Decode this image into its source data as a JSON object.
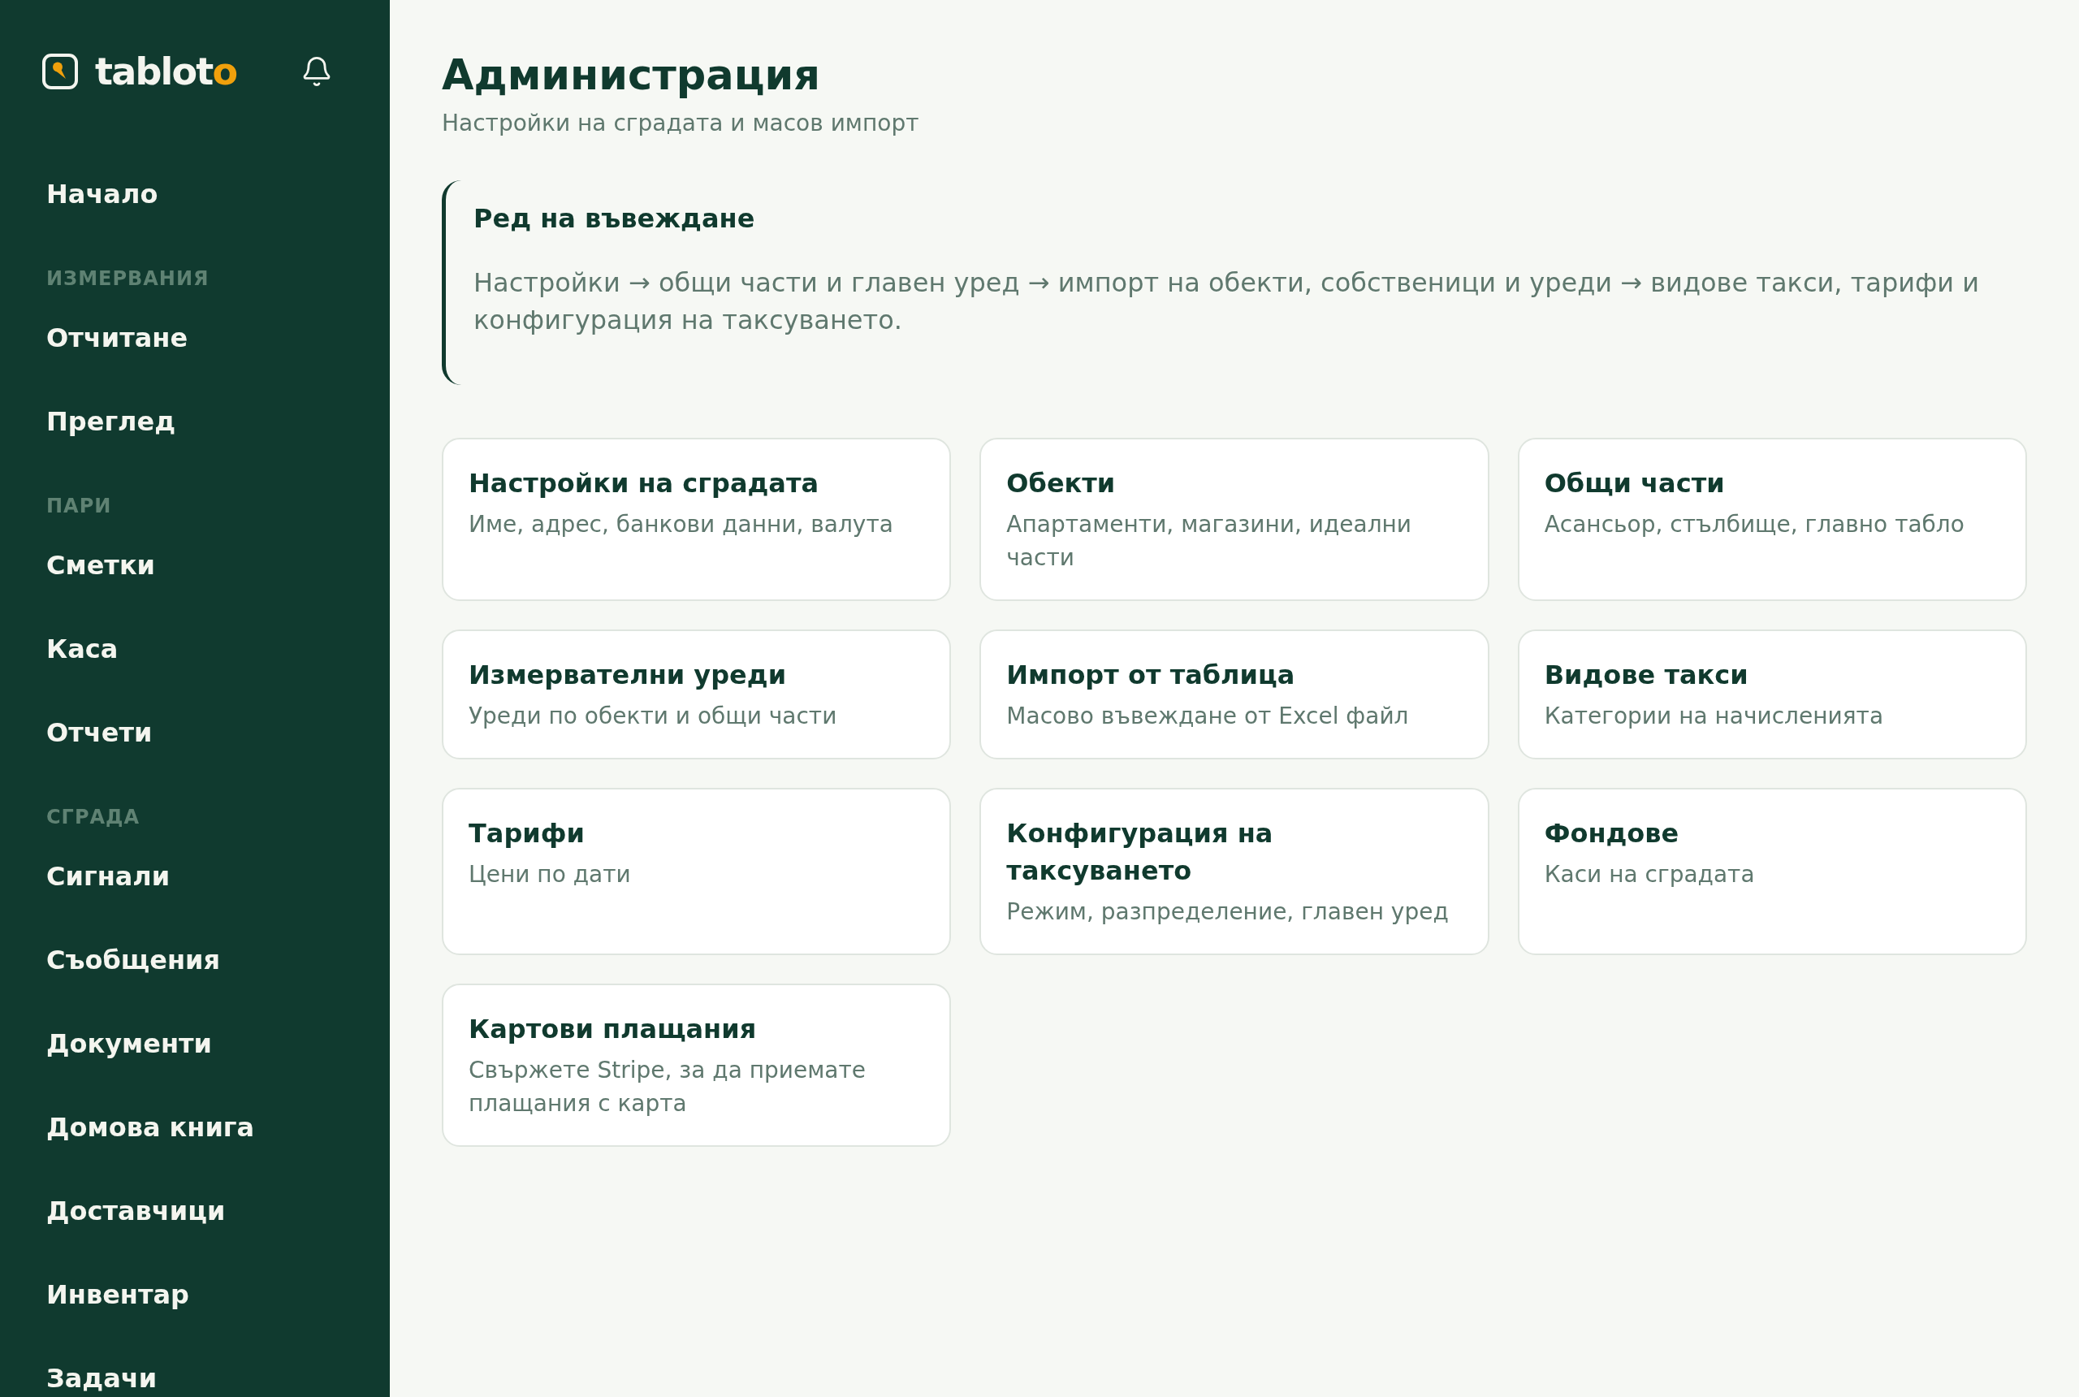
{
  "sidebar": {
    "logo": {
      "parts": [
        {
          "text": "tablot",
          "accent": false
        },
        {
          "text": "o",
          "accent": true
        }
      ]
    },
    "groups": [
      {
        "items": [
          {
            "label": "Начало",
            "selected": false
          }
        ]
      },
      {
        "heading": "ИЗМЕРВАНИЯ",
        "items": [
          {
            "label": "Отчитане",
            "selected": false
          },
          {
            "label": "Преглед",
            "selected": false
          }
        ]
      },
      {
        "heading": "ПАРИ",
        "items": [
          {
            "label": "Сметки",
            "selected": false
          },
          {
            "label": "Каса",
            "selected": false
          },
          {
            "label": "Отчети",
            "selected": false
          }
        ]
      },
      {
        "heading": "СГРАДА",
        "items": [
          {
            "label": "Сигнали",
            "selected": false
          },
          {
            "label": "Съобщения",
            "selected": false
          },
          {
            "label": "Документи",
            "selected": false
          },
          {
            "label": "Домова книга",
            "selected": false
          },
          {
            "label": "Доставчици",
            "selected": false
          },
          {
            "label": "Инвентар",
            "selected": false
          },
          {
            "label": "Задачи",
            "selected": false
          }
        ]
      }
    ]
  },
  "page": {
    "title": "Администрация",
    "subtitle": "Настройки на сградата и масов импорт"
  },
  "callout": {
    "title": "Ред на въвеждане",
    "text": "Настройки → общи части и главен уред → импорт на обекти, собственици и уреди → видове такси, тарифи и конфигурация на таксуването."
  },
  "cards": [
    {
      "title": "Настройки на сградата",
      "description": "Име, адрес, банкови данни, валута"
    },
    {
      "title": "Обекти",
      "description": "Апартаменти, магазини, идеални части"
    },
    {
      "title": "Общи части",
      "description": "Асансьор, стълбище, главно табло"
    },
    {
      "title": "Измервателни уреди",
      "description": "Уреди по обекти и общи части"
    },
    {
      "title": "Импорт от таблица",
      "description": "Масово въвеждане от Excel файл"
    },
    {
      "title": "Видове такси",
      "description": "Категории на начисленията"
    },
    {
      "title": "Тарифи",
      "description": "Цени по дати"
    },
    {
      "title": "Конфигурация на таксуването",
      "description": "Режим, разпределение, главен уред"
    },
    {
      "title": "Фондове",
      "description": "Каси на сградата"
    },
    {
      "title": "Картови плащания",
      "description": "Свържете Stripe, за да приемате плащания с карта"
    }
  ]
}
